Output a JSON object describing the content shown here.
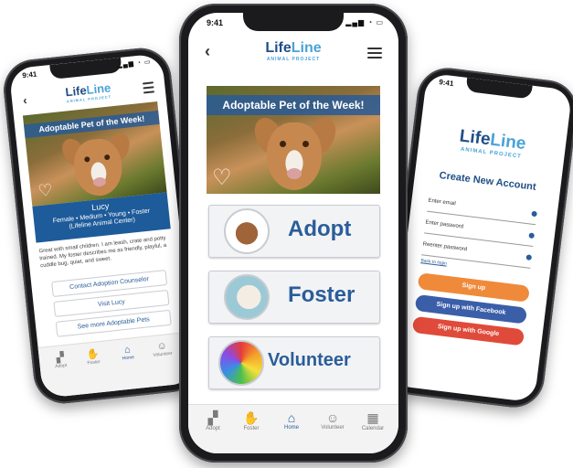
{
  "colors": {
    "brand": "#1f4f86",
    "accent": "#4aa3d8",
    "orange": "#ef8a3b",
    "facebook": "#3a5ea8",
    "google": "#e04a3a"
  },
  "logo": {
    "line1": "Life",
    "line2": "Line",
    "sub": "ANIMAL PROJECT"
  },
  "left_phone": {
    "time": "9:41",
    "banner": "Adoptable Pet of the Week!",
    "pet_name": "Lucy",
    "pet_details": "Female • Medium • Young • Foster",
    "pet_center": "(Lifeline Animal Center)",
    "description": "Great with small children. I am leash, crate and potty trained. My foster describes me as friendly, playful, a cuddle bug, quiet, and sweet.",
    "buttons": [
      "Contact Adoption Counselor",
      "Visit Lucy",
      "See more Adoptable Pets"
    ],
    "tabs": [
      "Adopt",
      "Foster",
      "Home",
      "Volunteer"
    ]
  },
  "center_phone": {
    "time": "9:41",
    "banner": "Adoptable Pet of the Week!",
    "menu": [
      "Adopt",
      "Foster",
      "Volunteer"
    ],
    "tabs": [
      "Adopt",
      "Foster",
      "Home",
      "Volunteer",
      "Calendar"
    ]
  },
  "right_phone": {
    "time": "9:41",
    "title": "Create New Account",
    "fields": [
      "Enter email",
      "Enter password",
      "Reenter password"
    ],
    "back_link": "Back to login",
    "buttons": [
      "Sign up",
      "Sign up with Facebook",
      "Sign up with Google"
    ]
  },
  "icons": {
    "back": "chevron-left-icon",
    "menu": "hamburger-icon",
    "heart": "heart-icon"
  }
}
